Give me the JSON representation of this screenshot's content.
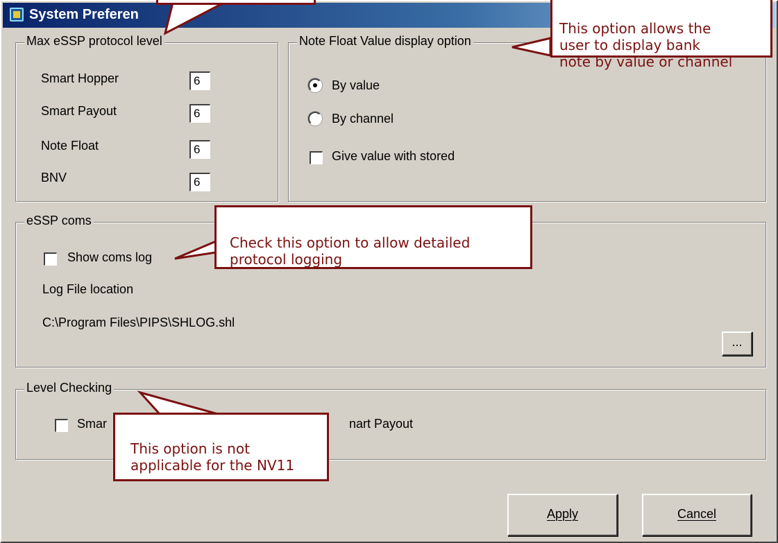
{
  "window": {
    "title": "System Preferen"
  },
  "max_essp": {
    "label": "Max eSSP protocol level",
    "rows": [
      {
        "label": "Smart Hopper",
        "value": "6"
      },
      {
        "label": "Smart Payout",
        "value": "6"
      },
      {
        "label": "Note Float",
        "value": "6"
      },
      {
        "label": "BNV",
        "value": "6"
      }
    ]
  },
  "note_float": {
    "label": "Note Float Value display option",
    "by_value": "By value",
    "by_channel": "By channel",
    "give_value": "Give value with stored",
    "selected": "by_value"
  },
  "coms": {
    "label": "eSSP coms",
    "show_log": "Show coms log",
    "log_location_label": "Log File location",
    "log_path": "C:\\Program Files\\PIPS\\SHLOG.shl",
    "browse": "..."
  },
  "level": {
    "label": "Level Checking",
    "smart_hopper_partial": "Smar",
    "smart_payout_partial": "nart Payout"
  },
  "buttons": {
    "apply": "Apply",
    "cancel": "Cancel"
  },
  "callouts": {
    "display": "This option allows the\nuser to display bank\nnote by value or channel",
    "logging": "Check this option to allow detailed\nprotocol logging",
    "nv11": "This option is not\napplicable for the NV11"
  },
  "colors": {
    "callout_border": "#7b1111",
    "dialog_bg": "#d4d0c8"
  }
}
